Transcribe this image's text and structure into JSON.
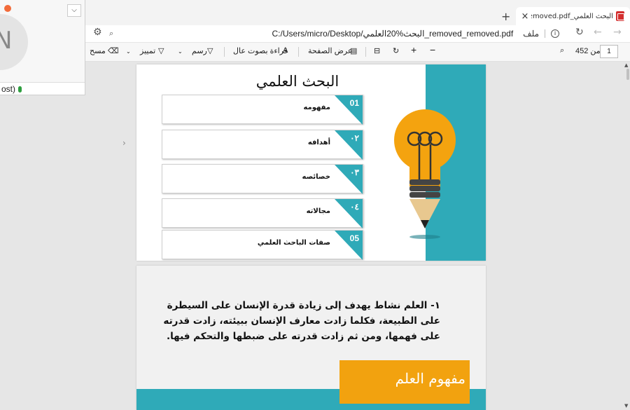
{
  "browser": {
    "tab_title": "البحث العلمي_removed_removed.pdf",
    "tab_close": "×",
    "new_tab": "+",
    "file_label": "ملف",
    "url": "C:/Users/micro/Desktop/البحث%20العلمي_removed_removed.pdf",
    "info_icon": "i"
  },
  "pdf_toolbar": {
    "page_current": "1",
    "page_total": "من 452",
    "zoom_out": "−",
    "zoom_in": "+",
    "page_view": "عرض الصفحة",
    "read_aloud": "قراءة بصوت عال",
    "draw": "رسم",
    "highlight": "تمييز",
    "erase": "مسح"
  },
  "mini_window": {
    "avatar_letter": "N",
    "status": "ost)",
    "dropdown": "⌵"
  },
  "page1": {
    "title": "البحث العلمي",
    "items": [
      {
        "num": "01",
        "label": "مفهومه"
      },
      {
        "num": "٠٢",
        "label": "أهدافه"
      },
      {
        "num": "٠٣",
        "label": "خصائصه"
      },
      {
        "num": "٠٤",
        "label": "مجالاته"
      },
      {
        "num": "05",
        "label": "صفات الباحث العلمي"
      }
    ]
  },
  "page2": {
    "paragraph": "١- العلم نشاط يهدف إلى زيادة قدرة الإنسان على السيطرة على الطبيعة، فكلما زادت معارف الإنسان ببيئته، زادت قدرته على فهمها، ومن ثم زادت قدرته على ضبطها والتحكم فيها.",
    "section_title": "مفهوم العلم"
  },
  "colors": {
    "teal": "#2faab8",
    "orange": "#f2a20f"
  }
}
